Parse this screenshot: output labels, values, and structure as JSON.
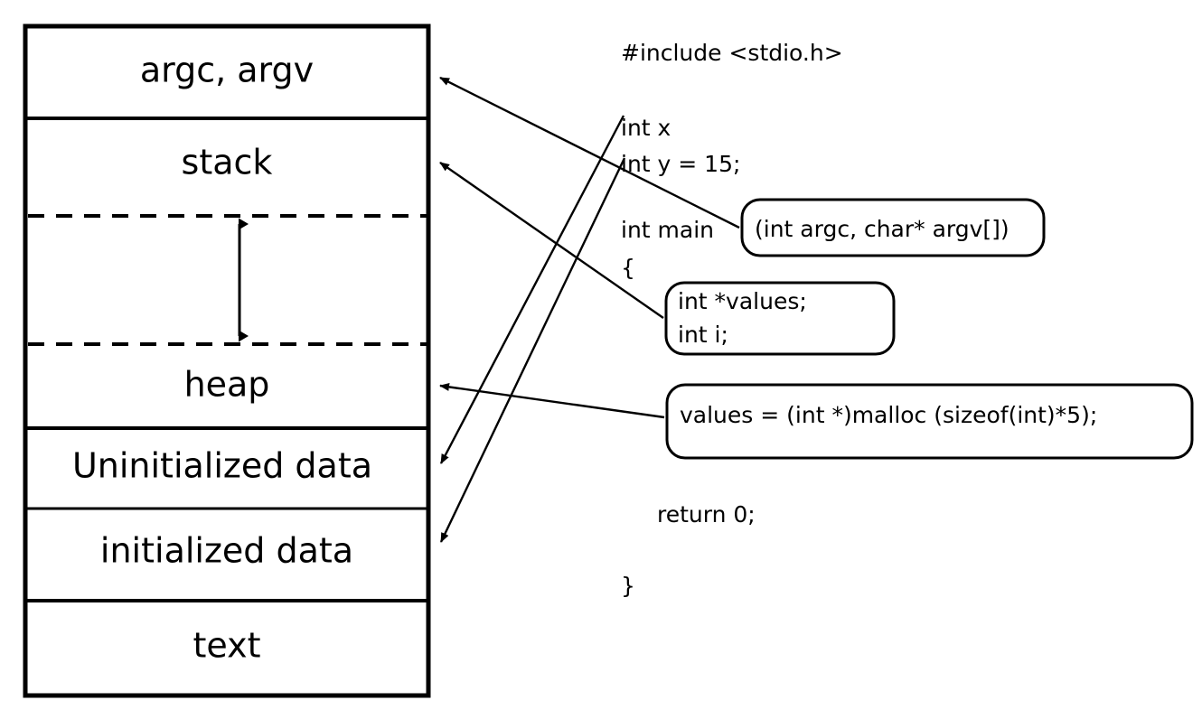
{
  "title": "C program memory layout with annotated source code",
  "memory_layout": {
    "name": "process-memory-segments",
    "segments": [
      {
        "id": "argc-argv",
        "label": "argc, argv"
      },
      {
        "id": "stack",
        "label": "stack"
      },
      {
        "id": "gap",
        "label": ""
      },
      {
        "id": "heap",
        "label": "heap"
      },
      {
        "id": "bss",
        "label": "Uninitialized data"
      },
      {
        "id": "data",
        "label": "initialized data"
      },
      {
        "id": "text",
        "label": "text"
      }
    ],
    "growth_arrow": {
      "name": "stack-heap-growth-arrow",
      "description": "double-headed vertical arrow between the two dashed boundaries"
    }
  },
  "code": {
    "name": "c-source-listing",
    "lines": [
      {
        "id": "include",
        "text": "#include <stdio.h>"
      },
      {
        "id": "decl-x",
        "text": "int x"
      },
      {
        "id": "decl-y",
        "text": "int y = 15;"
      },
      {
        "id": "main-sig",
        "text": "int main "
      },
      {
        "id": "open-brace",
        "text": "{"
      },
      {
        "id": "return",
        "text": "return 0;"
      },
      {
        "id": "close-brace",
        "text": "}"
      }
    ]
  },
  "callouts": [
    {
      "id": "main-params",
      "lines": [
        "(int argc, char* argv[])"
      ]
    },
    {
      "id": "locals",
      "lines": [
        "int *values;",
        "int i;"
      ]
    },
    {
      "id": "malloc-call",
      "lines": [
        "values = (int *)malloc (sizeof(int)*5);"
      ]
    }
  ],
  "connections": [
    {
      "id": "params-to-argcargv",
      "from": "main-params",
      "to": "argc-argv"
    },
    {
      "id": "locals-to-stack",
      "from": "locals",
      "to": "stack"
    },
    {
      "id": "malloc-to-heap",
      "from": "malloc-call",
      "to": "heap"
    },
    {
      "id": "x-to-bss",
      "from": "decl-x",
      "to": "bss"
    },
    {
      "id": "y-to-data",
      "from": "decl-y",
      "to": "data"
    }
  ],
  "colors": {
    "stroke": "#000000",
    "background": "#ffffff",
    "text": "#000000"
  }
}
